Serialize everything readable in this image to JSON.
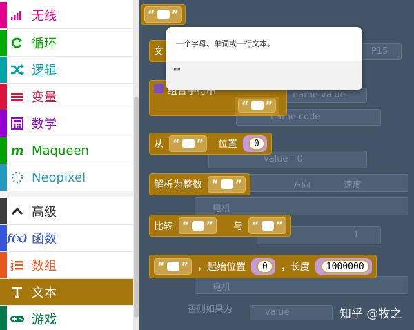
{
  "toolbox": {
    "categories": [
      {
        "label": "无线",
        "icon": "signal-bars-icon",
        "color": "#e3008c"
      },
      {
        "label": "循环",
        "icon": "loop-icon",
        "color": "#00aa00"
      },
      {
        "label": "逻辑",
        "icon": "shuffle-icon",
        "color": "#00a4a6"
      },
      {
        "label": "变量",
        "icon": "list-lines-icon",
        "color": "#dc143c"
      },
      {
        "label": "数学",
        "icon": "calculator-icon",
        "color": "#9400d3"
      },
      {
        "label": "Maqueen",
        "icon": "m-icon",
        "color": "#00a000"
      },
      {
        "label": "Neopixel",
        "icon": "dotted-circle-icon",
        "color": "#2699bf"
      },
      {
        "label": "高级",
        "icon": "chevron-up-icon",
        "color": "#3c3c3c"
      },
      {
        "label": "函数",
        "icon": "function-icon",
        "color": "#3455db"
      },
      {
        "label": "数组",
        "icon": "numbered-list-icon",
        "color": "#e65722"
      },
      {
        "label": "文本",
        "icon": "text-t-icon",
        "color": "#a5770c"
      },
      {
        "label": "游戏",
        "icon": "gamepad-icon",
        "color": "#007a4b"
      }
    ],
    "selected_index": 10
  },
  "blocks": {
    "quote_open": "“",
    "quote_close": "”",
    "substring_from": "从",
    "substring_position": "位置",
    "substring_position_value": "0",
    "parse_int_label": "解析为整数",
    "compare_label": "比较",
    "compare_and": "与",
    "partial_start_label": "，起始位置",
    "partial_start_value": "0",
    "partial_length_label": "，长度",
    "partial_length_value": "1000000",
    "partial_top_letter": "文",
    "partial_join_letters": "组合字符串"
  },
  "tooltip": {
    "description": "一个字母、单词或一行文本。",
    "value": "\"\""
  },
  "background_ghosts": {
    "p15": "P15",
    "name_value": "name value",
    "name_code": "name code",
    "value_minus": "value - 0",
    "direction": "方向",
    "speed": "速度",
    "motor": "电机",
    "one": "1",
    "else_if": "否则如果为",
    "value": "value"
  },
  "watermark": "知乎 @牧之"
}
